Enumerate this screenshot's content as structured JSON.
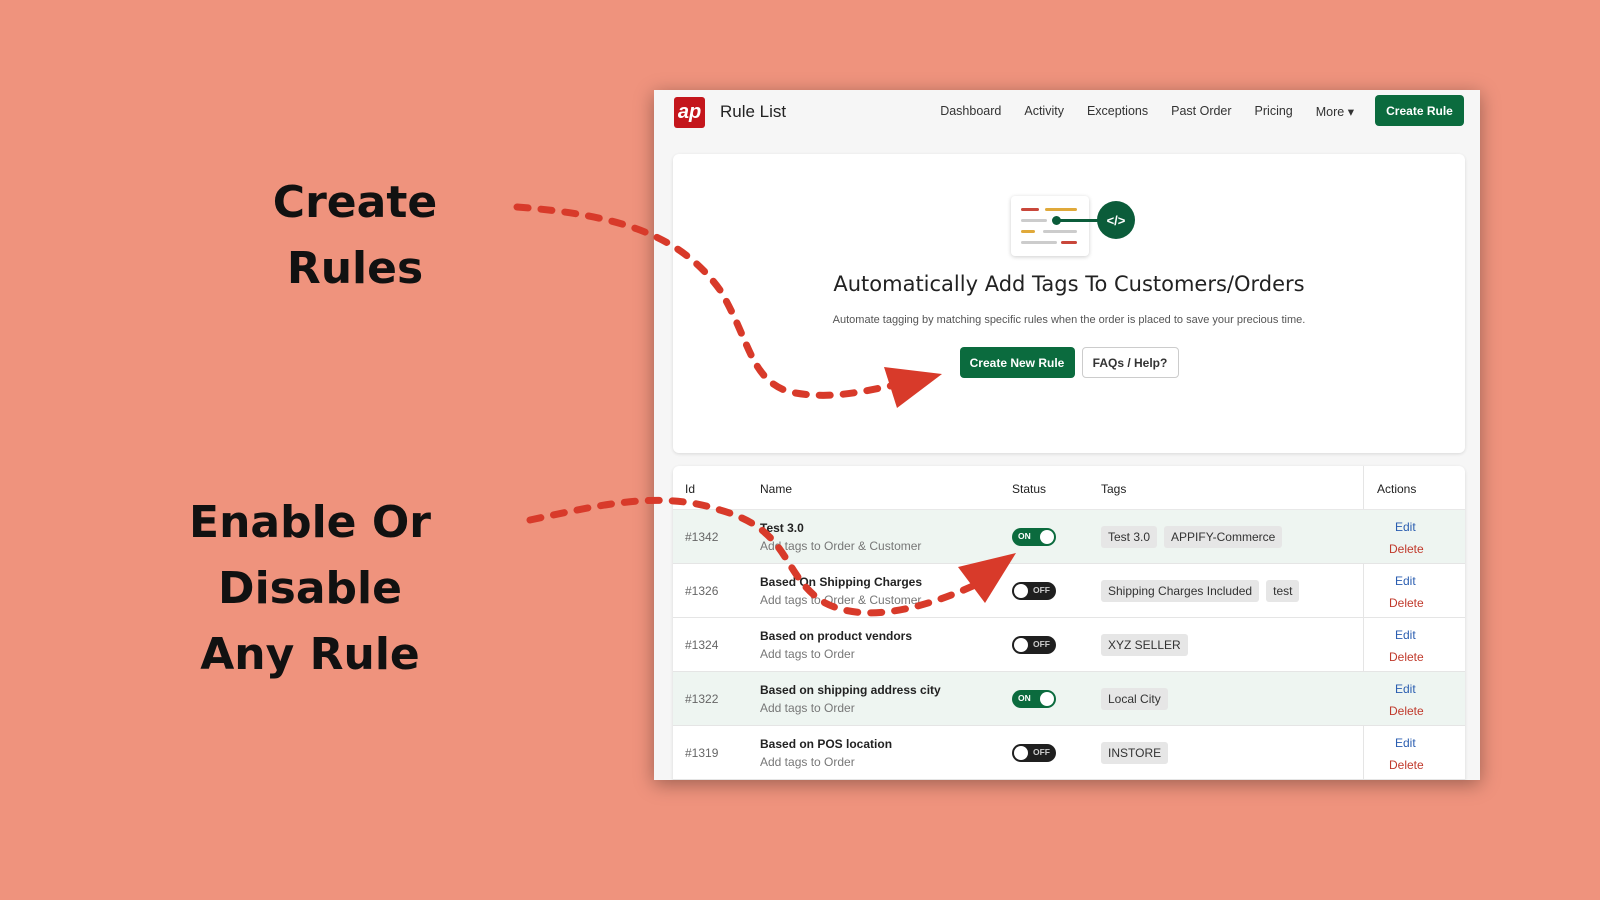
{
  "annotations": {
    "create_rules": "Create Rules",
    "enable_line1": "Enable Or Disable",
    "enable_line2": "Any Rule"
  },
  "app": {
    "logo_text": "ap",
    "title": "Rule List",
    "nav": [
      "Dashboard",
      "Activity",
      "Exceptions",
      "Past Order",
      "Pricing",
      "More ▾"
    ],
    "create_rule": "Create Rule"
  },
  "hero": {
    "title": "Automatically Add Tags To Customers/Orders",
    "subtitle": "Automate tagging by matching specific rules when the order is placed to save your precious time.",
    "create_new_rule": "Create New Rule",
    "faqs": "FAQs / Help?",
    "code_icon": "</>"
  },
  "table": {
    "headers": {
      "id": "Id",
      "name": "Name",
      "status": "Status",
      "tags": "Tags",
      "actions": "Actions"
    },
    "edit_label": "Edit",
    "delete_label": "Delete",
    "on_label": "ON",
    "off_label": "OFF",
    "rows": [
      {
        "id": "#1342",
        "name": "Test 3.0",
        "desc": "Add tags to Order & Customer",
        "status": true,
        "tags": [
          "Test 3.0",
          "APPIFY-Commerce"
        ]
      },
      {
        "id": "#1326",
        "name": "Based On Shipping Charges",
        "desc": "Add tags to Order & Customer",
        "status": false,
        "tags": [
          "Shipping Charges Included",
          "test"
        ]
      },
      {
        "id": "#1324",
        "name": "Based on product vendors",
        "desc": "Add tags to Order",
        "status": false,
        "tags": [
          "XYZ SELLER"
        ]
      },
      {
        "id": "#1322",
        "name": "Based on shipping address city",
        "desc": "Add tags to Order",
        "status": true,
        "tags": [
          "Local City"
        ]
      },
      {
        "id": "#1319",
        "name": "Based on POS location",
        "desc": "Add tags to Order",
        "status": false,
        "tags": [
          "INSTORE"
        ]
      }
    ]
  },
  "colors": {
    "background": "#ef937d",
    "brand_green": "#0b6b3e",
    "arrow_red": "#d83a2a",
    "logo_red": "#c4161c"
  }
}
